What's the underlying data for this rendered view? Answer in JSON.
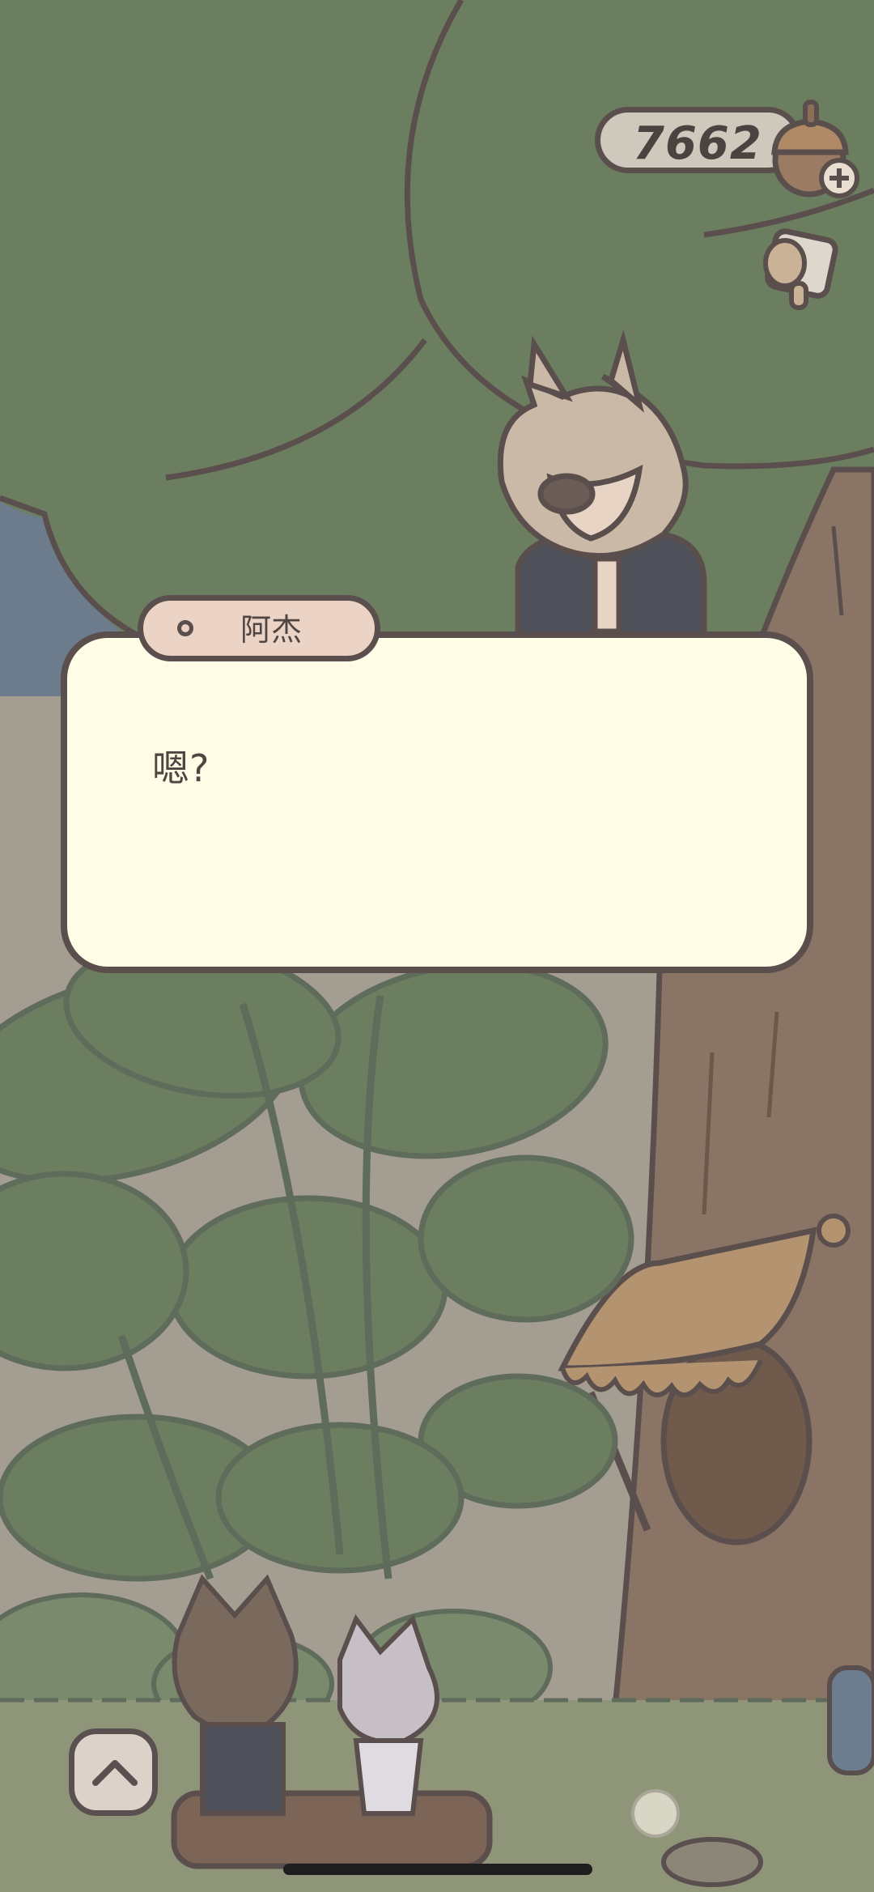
{
  "hud": {
    "coin_count": "7662",
    "coin_icon": "acorn-icon",
    "add_icon": "plus-icon",
    "item_icon": "cup-icon"
  },
  "dialog": {
    "speaker": "阿杰",
    "text": "嗯?"
  },
  "controls": {
    "expand_icon": "chevron-up-icon"
  },
  "colors": {
    "outline": "#5b4f4d",
    "dialog_bg": "#fffde6",
    "name_tab_bg": "#ebd4c6",
    "foliage": "#6c7e60",
    "trunk": "#8a7465",
    "sky": "#6b7d8e"
  }
}
